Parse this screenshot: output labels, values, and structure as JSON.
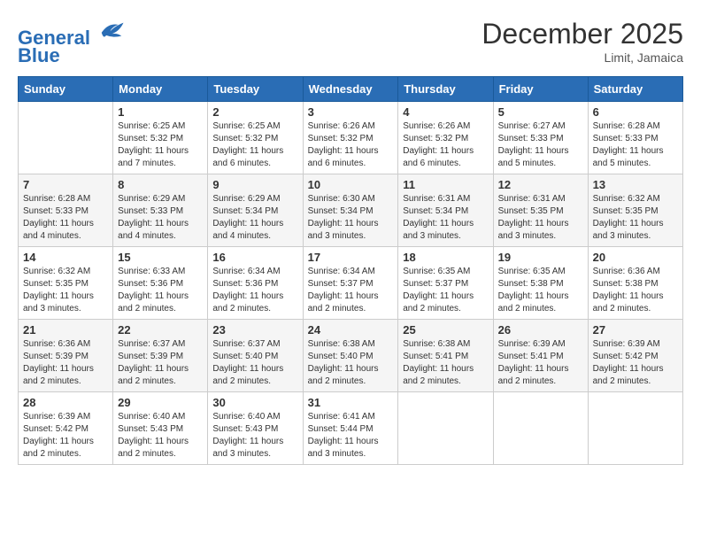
{
  "header": {
    "logo_line1": "General",
    "logo_line2": "Blue",
    "month": "December 2025",
    "location": "Limit, Jamaica"
  },
  "days_of_week": [
    "Sunday",
    "Monday",
    "Tuesday",
    "Wednesday",
    "Thursday",
    "Friday",
    "Saturday"
  ],
  "weeks": [
    [
      {
        "day": "",
        "info": ""
      },
      {
        "day": "1",
        "info": "Sunrise: 6:25 AM\nSunset: 5:32 PM\nDaylight: 11 hours\nand 7 minutes."
      },
      {
        "day": "2",
        "info": "Sunrise: 6:25 AM\nSunset: 5:32 PM\nDaylight: 11 hours\nand 6 minutes."
      },
      {
        "day": "3",
        "info": "Sunrise: 6:26 AM\nSunset: 5:32 PM\nDaylight: 11 hours\nand 6 minutes."
      },
      {
        "day": "4",
        "info": "Sunrise: 6:26 AM\nSunset: 5:32 PM\nDaylight: 11 hours\nand 6 minutes."
      },
      {
        "day": "5",
        "info": "Sunrise: 6:27 AM\nSunset: 5:33 PM\nDaylight: 11 hours\nand 5 minutes."
      },
      {
        "day": "6",
        "info": "Sunrise: 6:28 AM\nSunset: 5:33 PM\nDaylight: 11 hours\nand 5 minutes."
      }
    ],
    [
      {
        "day": "7",
        "info": "Sunrise: 6:28 AM\nSunset: 5:33 PM\nDaylight: 11 hours\nand 4 minutes."
      },
      {
        "day": "8",
        "info": "Sunrise: 6:29 AM\nSunset: 5:33 PM\nDaylight: 11 hours\nand 4 minutes."
      },
      {
        "day": "9",
        "info": "Sunrise: 6:29 AM\nSunset: 5:34 PM\nDaylight: 11 hours\nand 4 minutes."
      },
      {
        "day": "10",
        "info": "Sunrise: 6:30 AM\nSunset: 5:34 PM\nDaylight: 11 hours\nand 3 minutes."
      },
      {
        "day": "11",
        "info": "Sunrise: 6:31 AM\nSunset: 5:34 PM\nDaylight: 11 hours\nand 3 minutes."
      },
      {
        "day": "12",
        "info": "Sunrise: 6:31 AM\nSunset: 5:35 PM\nDaylight: 11 hours\nand 3 minutes."
      },
      {
        "day": "13",
        "info": "Sunrise: 6:32 AM\nSunset: 5:35 PM\nDaylight: 11 hours\nand 3 minutes."
      }
    ],
    [
      {
        "day": "14",
        "info": "Sunrise: 6:32 AM\nSunset: 5:35 PM\nDaylight: 11 hours\nand 3 minutes."
      },
      {
        "day": "15",
        "info": "Sunrise: 6:33 AM\nSunset: 5:36 PM\nDaylight: 11 hours\nand 2 minutes."
      },
      {
        "day": "16",
        "info": "Sunrise: 6:34 AM\nSunset: 5:36 PM\nDaylight: 11 hours\nand 2 minutes."
      },
      {
        "day": "17",
        "info": "Sunrise: 6:34 AM\nSunset: 5:37 PM\nDaylight: 11 hours\nand 2 minutes."
      },
      {
        "day": "18",
        "info": "Sunrise: 6:35 AM\nSunset: 5:37 PM\nDaylight: 11 hours\nand 2 minutes."
      },
      {
        "day": "19",
        "info": "Sunrise: 6:35 AM\nSunset: 5:38 PM\nDaylight: 11 hours\nand 2 minutes."
      },
      {
        "day": "20",
        "info": "Sunrise: 6:36 AM\nSunset: 5:38 PM\nDaylight: 11 hours\nand 2 minutes."
      }
    ],
    [
      {
        "day": "21",
        "info": "Sunrise: 6:36 AM\nSunset: 5:39 PM\nDaylight: 11 hours\nand 2 minutes."
      },
      {
        "day": "22",
        "info": "Sunrise: 6:37 AM\nSunset: 5:39 PM\nDaylight: 11 hours\nand 2 minutes."
      },
      {
        "day": "23",
        "info": "Sunrise: 6:37 AM\nSunset: 5:40 PM\nDaylight: 11 hours\nand 2 minutes."
      },
      {
        "day": "24",
        "info": "Sunrise: 6:38 AM\nSunset: 5:40 PM\nDaylight: 11 hours\nand 2 minutes."
      },
      {
        "day": "25",
        "info": "Sunrise: 6:38 AM\nSunset: 5:41 PM\nDaylight: 11 hours\nand 2 minutes."
      },
      {
        "day": "26",
        "info": "Sunrise: 6:39 AM\nSunset: 5:41 PM\nDaylight: 11 hours\nand 2 minutes."
      },
      {
        "day": "27",
        "info": "Sunrise: 6:39 AM\nSunset: 5:42 PM\nDaylight: 11 hours\nand 2 minutes."
      }
    ],
    [
      {
        "day": "28",
        "info": "Sunrise: 6:39 AM\nSunset: 5:42 PM\nDaylight: 11 hours\nand 2 minutes."
      },
      {
        "day": "29",
        "info": "Sunrise: 6:40 AM\nSunset: 5:43 PM\nDaylight: 11 hours\nand 2 minutes."
      },
      {
        "day": "30",
        "info": "Sunrise: 6:40 AM\nSunset: 5:43 PM\nDaylight: 11 hours\nand 3 minutes."
      },
      {
        "day": "31",
        "info": "Sunrise: 6:41 AM\nSunset: 5:44 PM\nDaylight: 11 hours\nand 3 minutes."
      },
      {
        "day": "",
        "info": ""
      },
      {
        "day": "",
        "info": ""
      },
      {
        "day": "",
        "info": ""
      }
    ]
  ]
}
